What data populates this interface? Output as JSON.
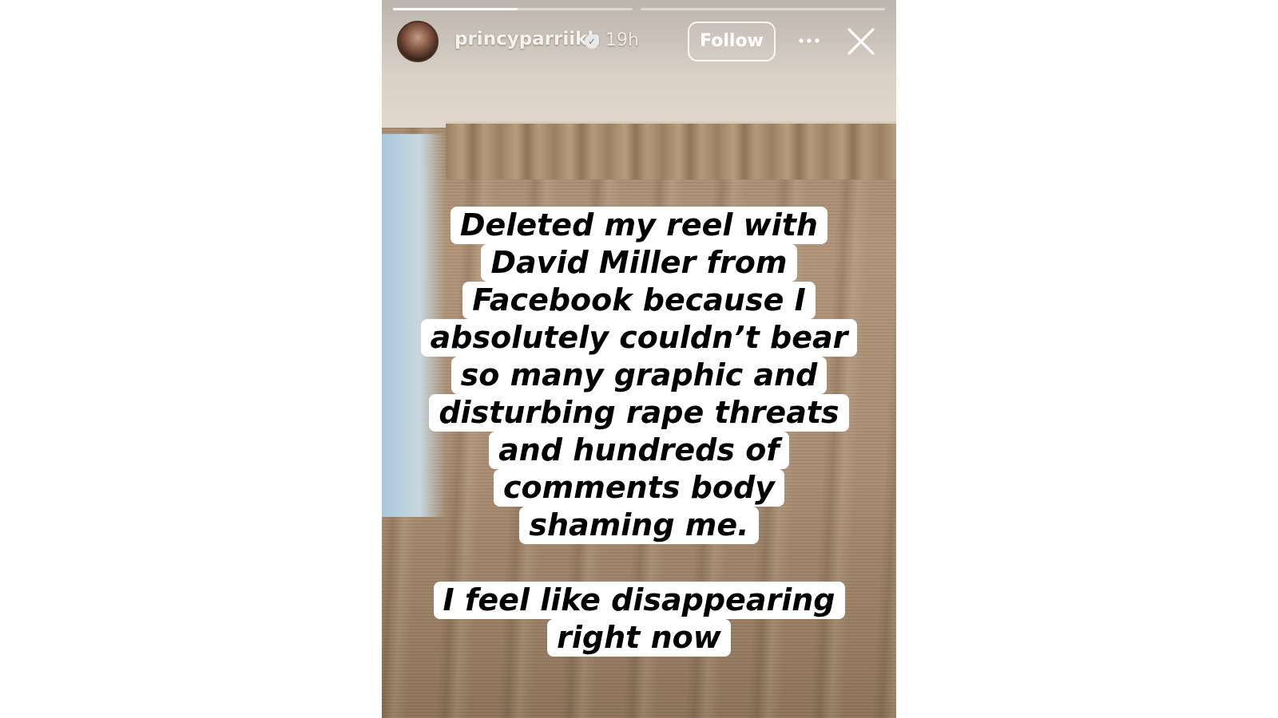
{
  "story": {
    "username": "princyparriikh",
    "verified_icon": "verified-badge-icon",
    "time_ago": "19h",
    "follow_label": "Follow",
    "more_icon": "more-options-icon",
    "close_icon": "close-icon",
    "progress": [
      {
        "fill": 0.52
      },
      {
        "fill": 0.0
      }
    ],
    "caption_1": [
      "Deleted my reel with",
      "David Miller from",
      "Facebook because I",
      "absolutely couldn’t bear",
      "so many graphic and",
      "disturbing rape threats",
      "and hundreds of",
      "comments body",
      "shaming me."
    ],
    "caption_2": [
      "I feel like disappearing",
      "right now"
    ]
  },
  "colors": {
    "caption_background": "#ffffff",
    "caption_text": "#000000",
    "curtain": "#a88d72"
  }
}
